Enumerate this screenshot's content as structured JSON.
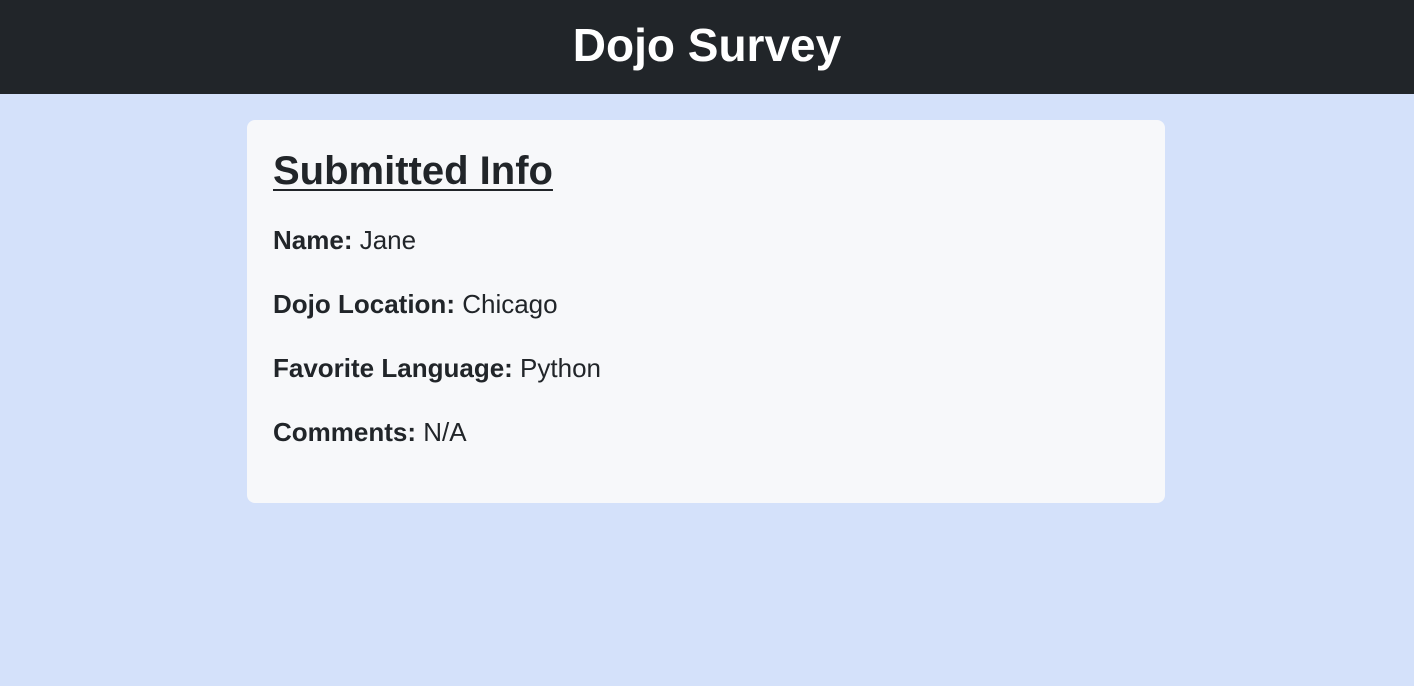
{
  "header": {
    "title": "Dojo Survey"
  },
  "card": {
    "title": "Submitted Info",
    "fields": [
      {
        "label": "Name:",
        "value": "Jane"
      },
      {
        "label": "Dojo Location:",
        "value": "Chicago"
      },
      {
        "label": "Favorite Language:",
        "value": "Python"
      },
      {
        "label": "Comments:",
        "value": "N/A"
      }
    ]
  },
  "colors": {
    "header_bg": "#212529",
    "page_bg": "#d4e1fa",
    "card_bg": "#f7f8fa",
    "text": "#212529"
  }
}
